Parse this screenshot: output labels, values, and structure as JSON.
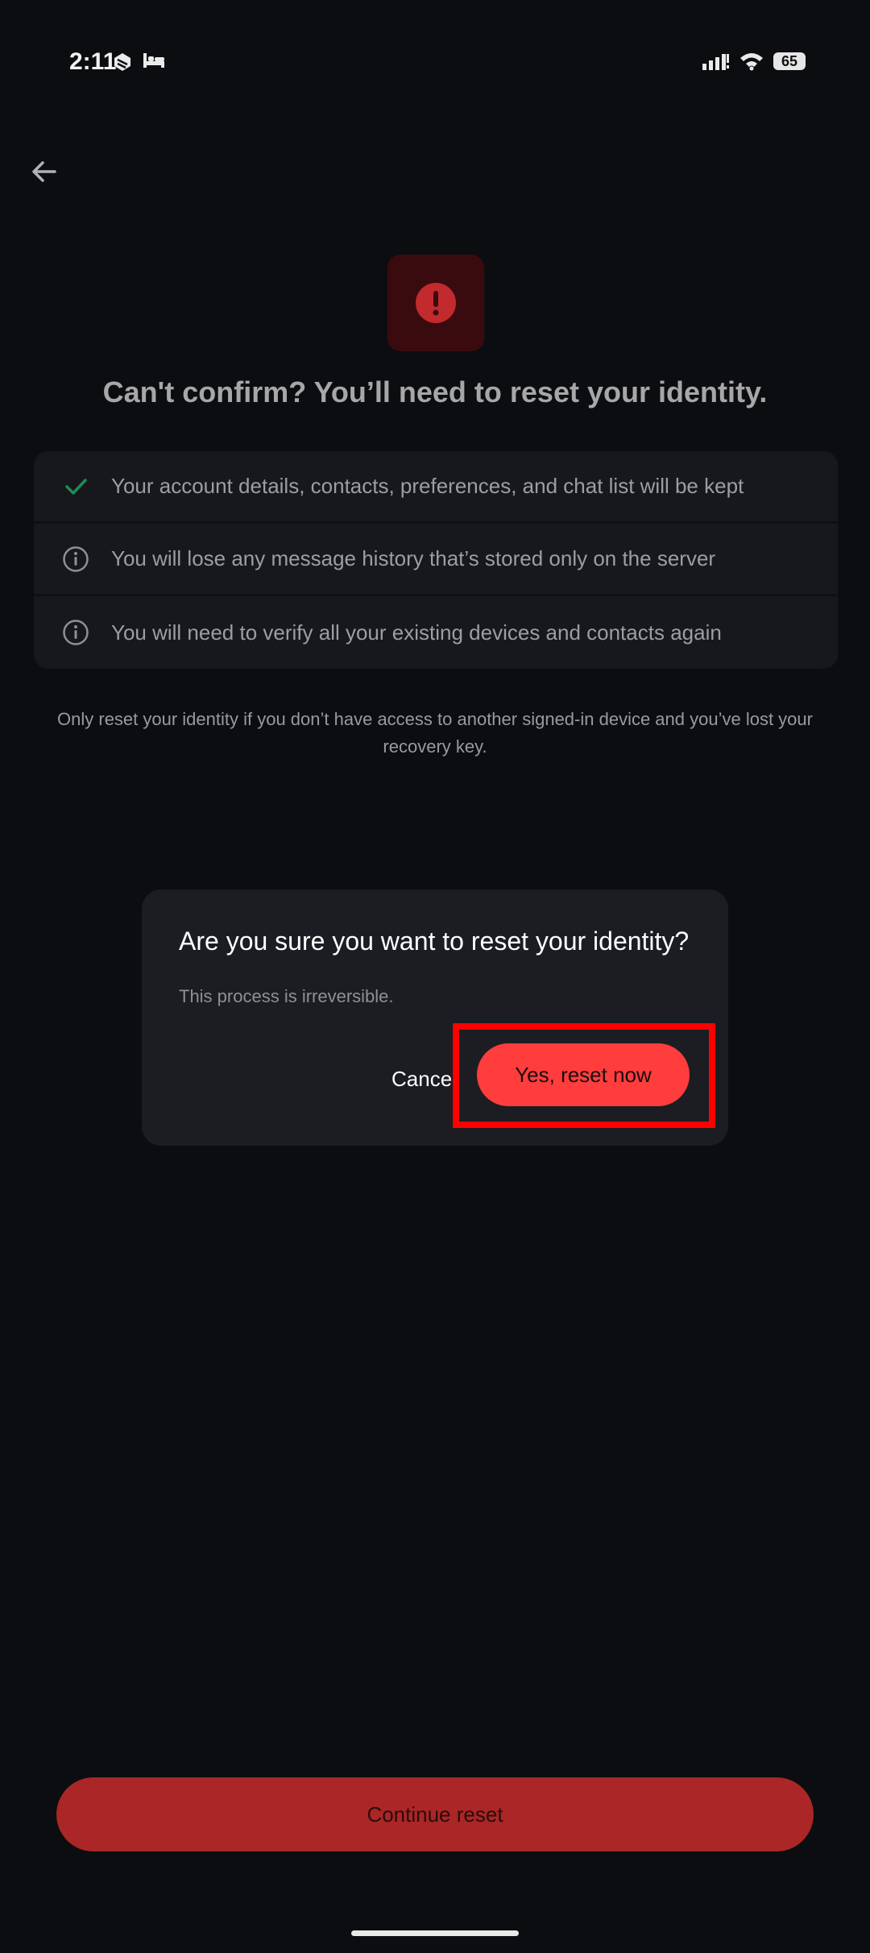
{
  "status_bar": {
    "time": "2:11",
    "battery": "65"
  },
  "header": {
    "back_icon": "arrow-left-icon"
  },
  "hero": {
    "icon": "exclamation-circle-icon",
    "title": "Can't confirm? You’ll need to reset your identity."
  },
  "info_list": [
    {
      "icon": "check-icon",
      "text": "Your account details, contacts, preferences, and chat list will be kept"
    },
    {
      "icon": "info-icon",
      "text": "You will lose any message history that’s stored only on the server"
    },
    {
      "icon": "info-icon",
      "text": "You will need to verify all your existing devices and contacts again"
    }
  ],
  "help_text": "Only reset your identity if you don’t have access to another signed-in device and you’ve lost your recovery key.",
  "dialog": {
    "title": "Are you sure you want to reset your identity?",
    "body": "This process is irreversible.",
    "cancel_label": "Cancel",
    "confirm_label": "Yes, reset now"
  },
  "footer": {
    "continue_label": "Continue reset"
  },
  "colors": {
    "background": "#0b0d11",
    "accent_red": "#ff3d3d",
    "dim_red": "#ab2626",
    "check_green": "#1f8a5b",
    "highlight": "#ff0000"
  }
}
